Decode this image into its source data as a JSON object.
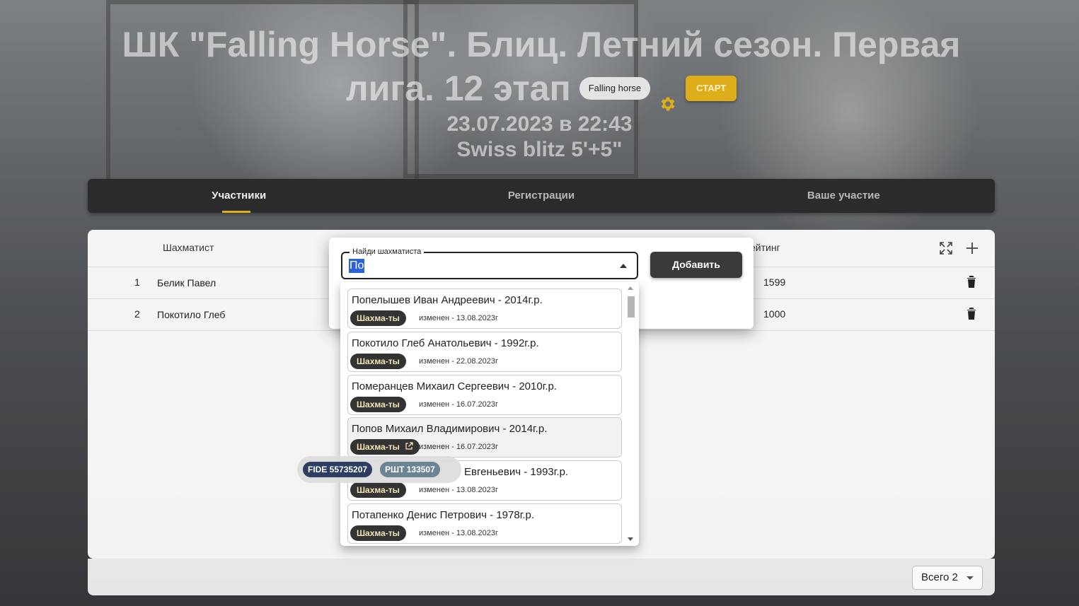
{
  "header": {
    "title_line1": "ШК \"Falling Horse\". Блиц. Летний сезон. Первая",
    "title_line2": "лига. 12 этап",
    "org_chip": "Falling horse",
    "start_label": "СТАРТ",
    "datetime": "23.07.2023 в 22:43",
    "format": "Swiss blitz 5'+5\""
  },
  "tabs": [
    {
      "label": "Участники",
      "active": true
    },
    {
      "label": "Регистрации",
      "active": false
    },
    {
      "label": "Ваше участие",
      "active": false
    }
  ],
  "table": {
    "col_player": "Шахматист",
    "col_rating": "ейтинг",
    "rows": [
      {
        "num": "1",
        "name": "Белик Павел",
        "rating": "1599"
      },
      {
        "num": "2",
        "name": "Покотило Глеб",
        "rating": "1000"
      }
    ]
  },
  "footer": {
    "total": "Всего 2"
  },
  "dialog": {
    "field_label": "Найди шахматиста",
    "field_value": "По",
    "add_label": "Добавить"
  },
  "options": [
    {
      "name": "Попелышев Иван Андреевич - 2014г.р.",
      "tag": "Шахма-ты",
      "updated": "изменен - 13.08.2023г"
    },
    {
      "name": "Покотило Глеб Анатольевич - 1992г.р.",
      "tag": "Шахма-ты",
      "updated": "изменен - 22.08.2023г"
    },
    {
      "name": "Померанцев Михаил Сергеевич - 2010г.р.",
      "tag": "Шахма-ты",
      "updated": "изменен - 16.07.2023г"
    },
    {
      "name": "Попов Михаил Владимирович - 2014г.р.",
      "tag": "Шахма-ты",
      "updated": "изменен - 16.07.2023г"
    },
    {
      "name": "Евгеньевич - 1993г.р.",
      "tag": "Шахма-ты",
      "updated": "изменен - 13.08.2023г"
    },
    {
      "name": "Потапенко Денис Петрович - 1978г.р.",
      "tag": "Шахма-ты",
      "updated": "изменен - 13.08.2023г"
    }
  ],
  "tooltip": {
    "fide": "FIDE 55735207",
    "rcf": "РШТ 133507"
  },
  "colors": {
    "accent": "#e0ad1a",
    "dark": "#2b2b2d",
    "selection": "#2b62d6",
    "fide_chip": "#2e3e63",
    "rcf_chip": "#6b8595"
  },
  "icons": {
    "settings": "gear-icon",
    "expand": "fullscreen-icon",
    "add": "plus-icon",
    "delete": "trash-icon",
    "external": "external-link-icon"
  }
}
